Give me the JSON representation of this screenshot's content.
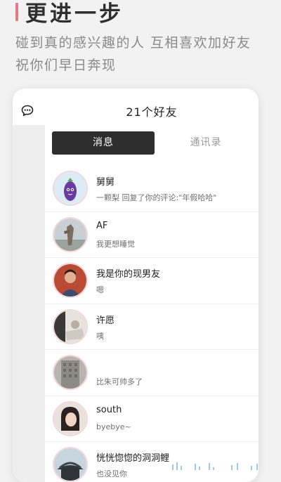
{
  "promo": {
    "headline": "更进一步",
    "subline_1": "碰到真的感兴趣的人 互相喜欢加好友",
    "subline_2": "祝你们早日奔现"
  },
  "header": {
    "title": "21个好友"
  },
  "tabs": [
    {
      "label": "消息",
      "active": true
    },
    {
      "label": "通讯录",
      "active": false
    }
  ],
  "contacts": [
    {
      "name": "舅舅",
      "message": "一颗梨 回复了你的评论:\"年假哈哈\"",
      "avatar": "eggplant-cartoon"
    },
    {
      "name": "AF",
      "message": "我更想睡觉",
      "avatar": "statue-photo"
    },
    {
      "name": "我是你的现男友",
      "message": "嗯",
      "avatar": "man-portrait-photo"
    },
    {
      "name": "许愿",
      "message": "咦",
      "avatar": "indoor-photo"
    },
    {
      "name": "",
      "message": "比朱可帅多了",
      "avatar": "building-photo"
    },
    {
      "name": "south",
      "message": "byebye~",
      "avatar": "woman-portrait-photo"
    },
    {
      "name": "恍恍惚惚的洞洞鲤",
      "message": "也没见你",
      "avatar": "temple-roof-photo"
    }
  ],
  "colors": {
    "accent": "#e4798a",
    "tab_active_bg": "#2e2e2e",
    "avatar_ring": "#f3d6db"
  },
  "icons": {
    "rail_icon": "chat-bubble-icon"
  }
}
